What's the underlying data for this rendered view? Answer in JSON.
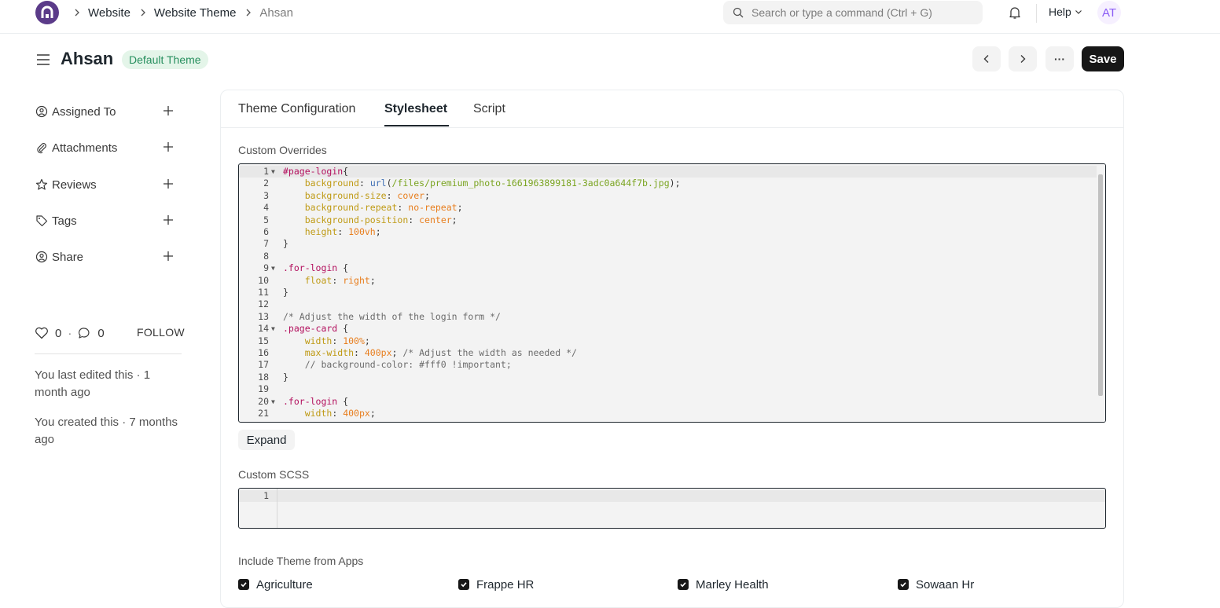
{
  "navbar": {
    "breadcrumbs": [
      "Website",
      "Website Theme",
      "Ahsan"
    ],
    "search_placeholder": "Search or type a command (Ctrl + G)",
    "help_label": "Help",
    "avatar_initials": "AT"
  },
  "page": {
    "title": "Ahsan",
    "status_badge": "Default Theme",
    "save_label": "Save",
    "more_label": "···"
  },
  "sidebar": {
    "items": [
      {
        "label": "Assigned To",
        "icon": "user-assign-icon"
      },
      {
        "label": "Attachments",
        "icon": "paperclip-icon"
      },
      {
        "label": "Reviews",
        "icon": "star-icon"
      },
      {
        "label": "Tags",
        "icon": "tag-icon"
      },
      {
        "label": "Share",
        "icon": "share-user-icon"
      }
    ],
    "likes_count": "0",
    "comments_count": "0",
    "dot": "·",
    "follow_label": "FOLLOW",
    "last_edited": "You last edited this · 1 month ago",
    "created": "You created this · 7 months ago"
  },
  "tabs": [
    {
      "label": "Theme Configuration",
      "active": false
    },
    {
      "label": "Stylesheet",
      "active": true
    },
    {
      "label": "Script",
      "active": false
    }
  ],
  "custom_overrides": {
    "label": "Custom Overrides",
    "lines": [
      {
        "n": "1",
        "fold": true,
        "code": "#page-login{"
      },
      {
        "n": "2",
        "fold": false,
        "code": "    background: url(/files/premium_photo-1661963899181-3adc0a644f7b.jpg);"
      },
      {
        "n": "3",
        "fold": false,
        "code": "    background-size: cover;"
      },
      {
        "n": "4",
        "fold": false,
        "code": "    background-repeat: no-repeat;"
      },
      {
        "n": "5",
        "fold": false,
        "code": "    background-position: center;"
      },
      {
        "n": "6",
        "fold": false,
        "code": "    height: 100vh;"
      },
      {
        "n": "7",
        "fold": false,
        "code": "}"
      },
      {
        "n": "8",
        "fold": false,
        "code": ""
      },
      {
        "n": "9",
        "fold": true,
        "code": ".for-login {"
      },
      {
        "n": "10",
        "fold": false,
        "code": "    float: right;"
      },
      {
        "n": "11",
        "fold": false,
        "code": "}"
      },
      {
        "n": "12",
        "fold": false,
        "code": ""
      },
      {
        "n": "13",
        "fold": false,
        "code": "/* Adjust the width of the login form */"
      },
      {
        "n": "14",
        "fold": true,
        "code": ".page-card {"
      },
      {
        "n": "15",
        "fold": false,
        "code": "    width: 100%;"
      },
      {
        "n": "16",
        "fold": false,
        "code": "    max-width: 400px; /* Adjust the width as needed */"
      },
      {
        "n": "17",
        "fold": false,
        "code": "    // background-color: #fff0 !important;"
      },
      {
        "n": "18",
        "fold": false,
        "code": "}"
      },
      {
        "n": "19",
        "fold": false,
        "code": ""
      },
      {
        "n": "20",
        "fold": true,
        "code": ".for-login {"
      },
      {
        "n": "21",
        "fold": false,
        "code": "    width: 400px;"
      }
    ],
    "expand_label": "Expand"
  },
  "custom_scss": {
    "label": "Custom SCSS",
    "line_number": "1"
  },
  "include_apps": {
    "label": "Include Theme from Apps",
    "apps": [
      {
        "label": "Agriculture",
        "checked": true
      },
      {
        "label": "Frappe HR",
        "checked": true
      },
      {
        "label": "Marley Health",
        "checked": true
      },
      {
        "label": "Sowaan Hr",
        "checked": true
      }
    ]
  },
  "colors": {
    "brand": "#5b3b89",
    "badge_bg": "#e4f5e9",
    "badge_text": "#278f5e",
    "save_bg": "#171717"
  }
}
